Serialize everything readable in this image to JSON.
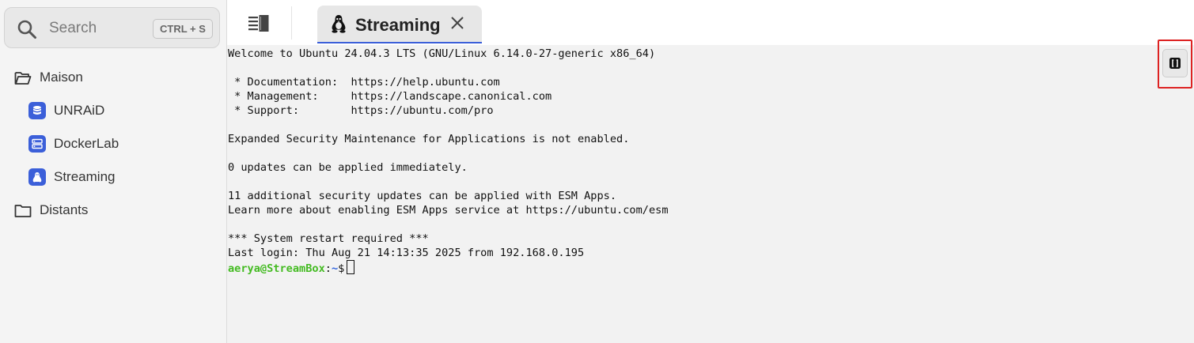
{
  "sidebar": {
    "search": {
      "placeholder": "Search",
      "shortcut": "CTRL + S"
    },
    "groups": [
      {
        "label": "Maison",
        "icon": "folder-open-icon"
      },
      {
        "label": "Distants",
        "icon": "folder-icon"
      }
    ],
    "hosts": [
      {
        "label": "UNRAiD",
        "icon": "database-icon"
      },
      {
        "label": "DockerLab",
        "icon": "server-icon"
      },
      {
        "label": "Streaming",
        "icon": "linux-penguin-icon"
      }
    ]
  },
  "tabs": [
    {
      "label": "Streaming",
      "icon": "linux-penguin-icon",
      "active": true
    }
  ],
  "terminal": {
    "lines": [
      "Welcome to Ubuntu 24.04.3 LTS (GNU/Linux 6.14.0-27-generic x86_64)",
      "",
      " * Documentation:  https://help.ubuntu.com",
      " * Management:     https://landscape.canonical.com",
      " * Support:        https://ubuntu.com/pro",
      "",
      "Expanded Security Maintenance for Applications is not enabled.",
      "",
      "0 updates can be applied immediately.",
      "",
      "11 additional security updates can be applied with ESM Apps.",
      "Learn more about enabling ESM Apps service at https://ubuntu.com/esm",
      "",
      "*** System restart required ***",
      "Last login: Thu Aug 21 14:13:35 2025 from 192.168.0.195"
    ],
    "prompt": {
      "user": "aerya@StreamBox",
      "sep": ":",
      "path": "~",
      "symbol": "$"
    }
  },
  "colors": {
    "accent": "#3b5fd9",
    "prompt_user": "#44bb22",
    "prompt_path": "#3366dd",
    "highlight": "#dd2222"
  },
  "floating_button": {
    "icon": "snippet-brackets-icon"
  }
}
